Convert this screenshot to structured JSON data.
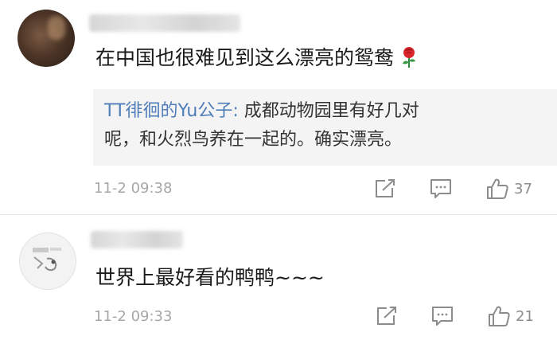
{
  "comments": [
    {
      "text": "在中国也很难见到这么漂亮的鸳鸯",
      "emoji": "rose-icon",
      "reply": {
        "author": "TT徘徊的Yu公子:",
        "text_line1": " 成都动物园里有好几对",
        "text_line2": "呢，和火烈鸟养在一起的。确实漂亮。"
      },
      "time": "11-2 09:38",
      "likes": "37"
    },
    {
      "text": "世界上最好看的鸭鸭~~~",
      "time": "11-2 09:33",
      "likes": "21"
    }
  ],
  "colors": {
    "link": "#4f7db9",
    "meta": "#a7a7a7",
    "icon": "#8c8c8c",
    "reply_bg": "#f4f4f4"
  }
}
